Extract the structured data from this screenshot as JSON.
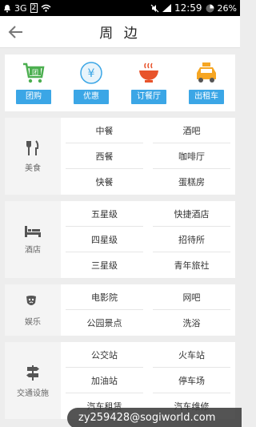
{
  "status": {
    "network": "3G",
    "sim": "2",
    "time": "12:59",
    "battery": "26%"
  },
  "header": {
    "title": "周 边"
  },
  "quick": [
    {
      "label": "团购",
      "icon": "cart-icon"
    },
    {
      "label": "优惠",
      "icon": "yen-coin-icon"
    },
    {
      "label": "订餐厅",
      "icon": "bowl-icon"
    },
    {
      "label": "出租车",
      "icon": "taxi-icon"
    }
  ],
  "categories": {
    "food": {
      "label": "美食",
      "items": [
        "中餐",
        "酒吧",
        "西餐",
        "咖啡厅",
        "快餐",
        "蛋糕房"
      ]
    },
    "hotel": {
      "label": "酒店",
      "items": [
        "五星级",
        "快捷酒店",
        "四星级",
        "招待所",
        "三星级",
        "青年旅社"
      ]
    },
    "fun": {
      "label": "娱乐",
      "items": [
        "电影院",
        "网吧",
        "公园景点",
        "洗浴"
      ]
    },
    "traffic": {
      "label": "交通设施",
      "items": [
        "公交站",
        "火车站",
        "加油站",
        "停车场",
        "汽车租赁",
        "汽车维修"
      ]
    }
  },
  "toast": {
    "text": "zy259428@sogiworld.com"
  }
}
